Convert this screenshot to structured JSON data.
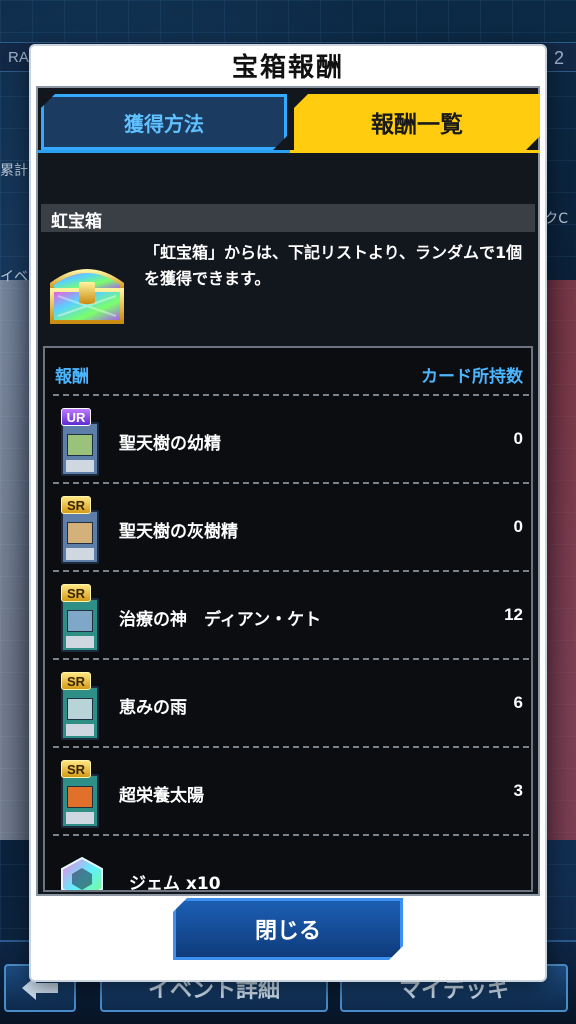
{
  "background": {
    "topbar_left": "RAID E",
    "topbar_right": "2",
    "side_left": "累計",
    "side_right": "クC",
    "side_left2": "イベ",
    "buttons": {
      "event": "イベント詳細",
      "deck": "マイデッキ"
    }
  },
  "modal": {
    "title": "宝箱報酬",
    "tabs": [
      {
        "label": "獲得方法",
        "active": false
      },
      {
        "label": "報酬一覧",
        "active": true
      }
    ],
    "section_title": "虹宝箱",
    "description": "「虹宝箱」からは、下記リストより、ランダムで1個を獲得できます。",
    "list_header": {
      "reward": "報酬",
      "owned": "カード所持数"
    },
    "rewards": [
      {
        "rarity": "UR",
        "name": "聖天樹の幼精",
        "count": "0",
        "card_type": "link"
      },
      {
        "rarity": "SR",
        "name": "聖天樹の灰樹精",
        "count": "0",
        "card_type": "link"
      },
      {
        "rarity": "SR",
        "name": "治療の神　ディアン・ケト",
        "count": "12",
        "card_type": "spell"
      },
      {
        "rarity": "SR",
        "name": "恵みの雨",
        "count": "6",
        "card_type": "spell"
      },
      {
        "rarity": "SR",
        "name": "超栄養太陽",
        "count": "3",
        "card_type": "spell"
      },
      {
        "rarity": "",
        "name": "ジェム x10",
        "count": "",
        "card_type": "gem"
      }
    ],
    "close_label": "閉じる"
  },
  "colors": {
    "accent_yellow": "#ffcc10",
    "tab_blue": "#33aaff",
    "header_blue": "#4bb6ff",
    "button_blue": "#1c5fb3"
  }
}
